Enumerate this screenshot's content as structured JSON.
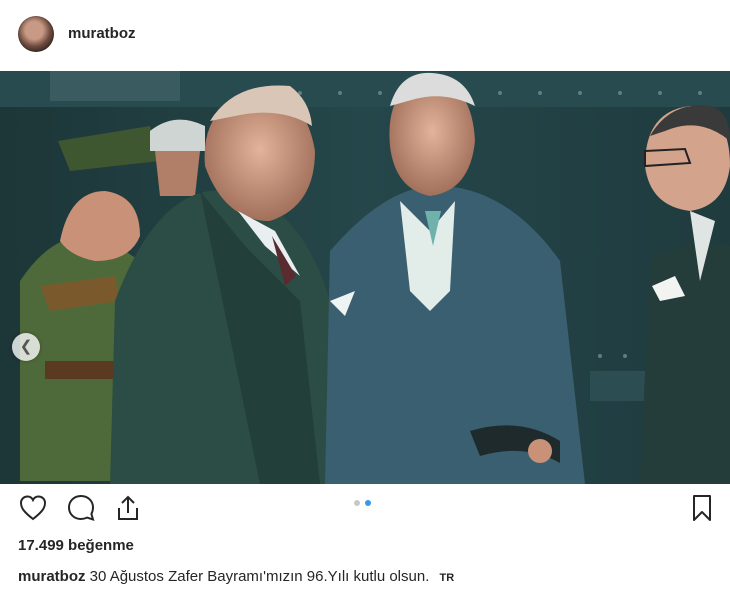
{
  "post": {
    "username": "muratboz",
    "likes_text": "17.499 beğenme",
    "caption_text": "30 Ağustos Zafer Bayramı'mızın 96.Yılı kutlu olsun.",
    "language_badge": "TR"
  },
  "carousel": {
    "slide_count": 2,
    "active_index": 1,
    "prev_icon": "chevron-left-icon"
  },
  "icons": {
    "like": "heart-icon",
    "comment": "comment-icon",
    "share": "share-icon",
    "save": "bookmark-icon"
  },
  "colors": {
    "active_dot": "#3897f0",
    "inactive_dot": "#c7c7c7",
    "text": "#262626"
  }
}
